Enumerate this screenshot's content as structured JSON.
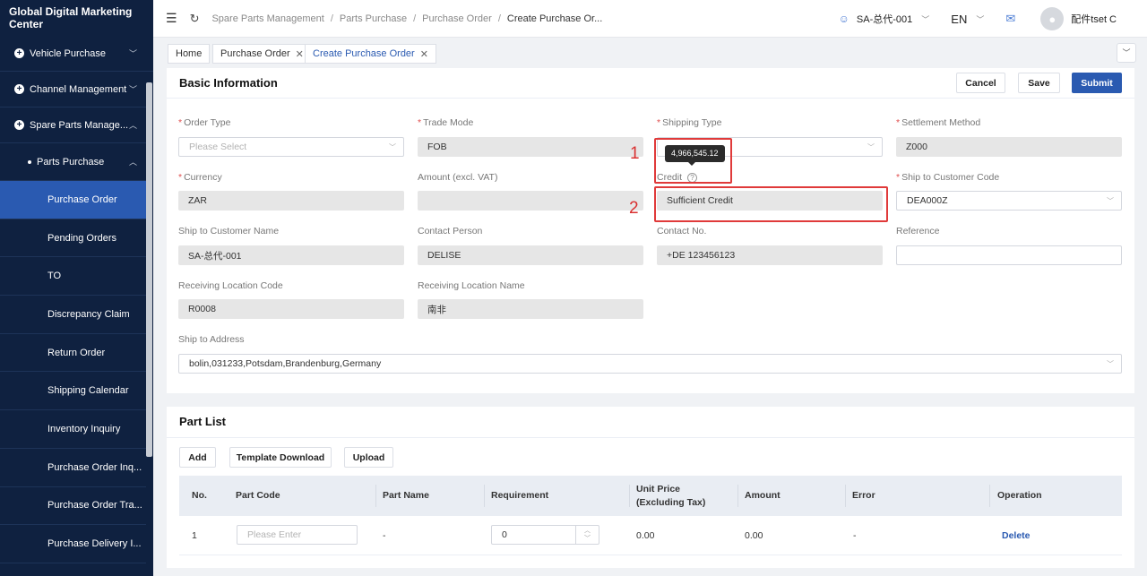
{
  "app": {
    "title": "Global Digital Marketing Center"
  },
  "sidebar": {
    "groups": [
      {
        "label": "Vehicle Purchase"
      },
      {
        "label": "Channel Management"
      },
      {
        "label": "Spare Parts Manage..."
      }
    ],
    "submenu": {
      "label": "Parts Purchase"
    },
    "leaves": [
      "Purchase Order",
      "Pending Orders",
      "TO",
      "Discrepancy Claim",
      "Return Order",
      "Shipping Calendar",
      "Inventory Inquiry",
      "Purchase Order Inq...",
      "Purchase Order Tra...",
      "Purchase Delivery I..."
    ],
    "active_leaf": "Purchase Order"
  },
  "header": {
    "breadcrumb": [
      "Spare Parts Management",
      "Parts Purchase",
      "Purchase Order",
      "Create Purchase Or..."
    ],
    "account": "SA-总代-001",
    "language": "EN",
    "username": "配件tset C"
  },
  "tabs": {
    "items": [
      {
        "label": "Home"
      },
      {
        "label": "Purchase Order"
      },
      {
        "label": "Create Purchase Order"
      }
    ]
  },
  "basic_info": {
    "title": "Basic Information",
    "buttons": {
      "cancel": "Cancel",
      "save": "Save",
      "submit": "Submit"
    },
    "fields": {
      "order_type": {
        "label": "Order Type",
        "placeholder": "Please Select"
      },
      "trade_mode": {
        "label": "Trade Mode",
        "value": "FOB"
      },
      "shipping_type": {
        "label": "Shipping Type",
        "value": ""
      },
      "settlement_method": {
        "label": "Settlement Method",
        "value": "Z000"
      },
      "currency": {
        "label": "Currency",
        "value": "ZAR"
      },
      "amount": {
        "label": "Amount (excl. VAT)",
        "value": ""
      },
      "credit": {
        "label": "Credit",
        "value": "Sufficient Credit",
        "tooltip": "4,966,545.12"
      },
      "ship_to_code": {
        "label": "Ship to Customer Code",
        "value": "DEA000Z"
      },
      "ship_to_name": {
        "label": "Ship to Customer Name",
        "value": "SA-总代-001"
      },
      "contact_person": {
        "label": "Contact Person",
        "value": "DELISE"
      },
      "contact_no": {
        "label": "Contact No.",
        "value": "+DE 123456123"
      },
      "reference": {
        "label": "Reference",
        "value": ""
      },
      "receiving_code": {
        "label": "Receiving Location Code",
        "value": "R0008"
      },
      "receiving_name": {
        "label": "Receiving Location Name",
        "value": "南非"
      },
      "ship_to_address": {
        "label": "Ship to Address",
        "value": "bolin,031233,Potsdam,Brandenburg,Germany"
      }
    },
    "annotations": {
      "marker1": "1",
      "marker2": "2"
    }
  },
  "part_list": {
    "title": "Part List",
    "buttons": {
      "add": "Add",
      "template": "Template Download",
      "upload": "Upload"
    },
    "columns": [
      "No.",
      "Part Code",
      "Part Name",
      "Requirement",
      "Unit Price (Excluding Tax)",
      "Amount",
      "Error",
      "Operation"
    ],
    "rows": [
      {
        "no": "1",
        "part_code_placeholder": "Please Enter",
        "part_name": "-",
        "requirement": "0",
        "unit_price": "0.00",
        "amount": "0.00",
        "error": "-",
        "operation": "Delete"
      }
    ]
  },
  "colors": {
    "sidebar_bg": "#0f2140",
    "accent": "#2a5ab1",
    "highlight": "#e03a3a"
  }
}
